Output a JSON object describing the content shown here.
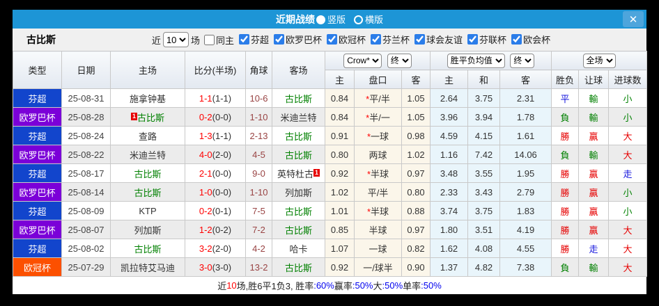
{
  "titlebar": {
    "title": "近期战绩",
    "vertical_label": "竖版",
    "horizontal_label": "横版",
    "close_glyph": "✕"
  },
  "filter": {
    "team": "古比斯",
    "near_label": "近",
    "games_value": "10",
    "games_suffix": "场",
    "same_home": {
      "label": "同主",
      "checked": false
    },
    "leagues": [
      {
        "label": "芬超",
        "checked": true
      },
      {
        "label": "欧罗巴杯",
        "checked": true
      },
      {
        "label": "欧冠杯",
        "checked": true
      },
      {
        "label": "芬兰杯",
        "checked": true
      },
      {
        "label": "球会友谊",
        "checked": true
      },
      {
        "label": "芬联杯",
        "checked": true
      },
      {
        "label": "欧会杯",
        "checked": true
      }
    ]
  },
  "colors": {
    "titlebar": "#1d95d6",
    "win_red": "#e60000",
    "lose_green": "#008000",
    "draw_blue": "#1414dd",
    "focus_team_green": "#008000",
    "score_red": "#ff0000",
    "corner_maroon": "#994444",
    "card_red": "#e60000",
    "percent_blue": "#0000ee"
  },
  "league_colors": {
    "芬超": "#1245cc",
    "欧罗巴杯": "#7b00d8",
    "欧冠杯": "#fc5000"
  },
  "table": {
    "columns_left": [
      "类型",
      "日期",
      "主场",
      "比分(半场)",
      "角球",
      "客场"
    ],
    "sub_columns": [
      "主",
      "盘口",
      "客",
      "主",
      "和",
      "客",
      "胜负",
      "让球",
      "进球数"
    ],
    "group1": {
      "select1": "Crow*",
      "select2": "终"
    },
    "group2": {
      "select1": "胜平负均值",
      "select2": "终"
    },
    "group3": {
      "select1": "全场"
    },
    "focus_team": "古比斯",
    "rows": [
      {
        "league": "芬超",
        "date": "25-08-31",
        "home": "施拿钟基",
        "away": "古比斯",
        "ft": "1-1",
        "ht": "(1-1)",
        "corners": "10-6",
        "crow": [
          "0.84",
          "*平/半",
          "1.05"
        ],
        "avg": [
          "2.64",
          "3.75",
          "2.31"
        ],
        "outcome": "平",
        "handicap": "輸",
        "goals": "小"
      },
      {
        "league": "欧罗巴杯",
        "date": "25-08-28",
        "home": "古比斯",
        "home_card": "1",
        "away": "米迪兰特",
        "ft": "0-2",
        "ht": "(0-0)",
        "corners": "1-10",
        "crow": [
          "0.84",
          "*半/一",
          "1.05"
        ],
        "avg": [
          "3.96",
          "3.94",
          "1.78"
        ],
        "outcome": "負",
        "handicap": "輸",
        "goals": "小"
      },
      {
        "league": "芬超",
        "date": "25-08-24",
        "home": "查路",
        "away": "古比斯",
        "ft": "1-3",
        "ht": "(1-1)",
        "corners": "2-13",
        "crow": [
          "0.91",
          "*一球",
          "0.98"
        ],
        "avg": [
          "4.59",
          "4.15",
          "1.61"
        ],
        "outcome": "勝",
        "handicap": "贏",
        "goals": "大"
      },
      {
        "league": "欧罗巴杯",
        "date": "25-08-22",
        "home": "米迪兰特",
        "away": "古比斯",
        "ft": "4-0",
        "ht": "(2-0)",
        "corners": "4-5",
        "crow": [
          "0.80",
          "两球",
          "1.02"
        ],
        "avg": [
          "1.16",
          "7.42",
          "14.06"
        ],
        "outcome": "負",
        "handicap": "輸",
        "goals": "大"
      },
      {
        "league": "芬超",
        "date": "25-08-17",
        "home": "古比斯",
        "away": "英特杜古",
        "away_card": "1",
        "ft": "2-1",
        "ht": "(0-0)",
        "corners": "9-0",
        "crow": [
          "0.92",
          "*半球",
          "0.97"
        ],
        "avg": [
          "3.48",
          "3.55",
          "1.95"
        ],
        "outcome": "勝",
        "handicap": "贏",
        "goals": "走"
      },
      {
        "league": "欧罗巴杯",
        "date": "25-08-14",
        "home": "古比斯",
        "away": "列加斯",
        "ft": "1-0",
        "ht": "(0-0)",
        "corners": "1-10",
        "crow": [
          "1.02",
          "平/半",
          "0.80"
        ],
        "avg": [
          "2.33",
          "3.43",
          "2.79"
        ],
        "outcome": "勝",
        "handicap": "贏",
        "goals": "小"
      },
      {
        "league": "芬超",
        "date": "25-08-09",
        "home": "KTP",
        "away": "古比斯",
        "ft": "0-2",
        "ht": "(0-1)",
        "corners": "7-5",
        "crow": [
          "1.01",
          "*半球",
          "0.88"
        ],
        "avg": [
          "3.74",
          "3.75",
          "1.83"
        ],
        "outcome": "勝",
        "handicap": "贏",
        "goals": "小"
      },
      {
        "league": "欧罗巴杯",
        "date": "25-08-07",
        "home": "列加斯",
        "away": "古比斯",
        "ft": "1-2",
        "ht": "(0-2)",
        "corners": "7-2",
        "crow": [
          "0.85",
          "半球",
          "0.97"
        ],
        "avg": [
          "1.80",
          "3.51",
          "4.19"
        ],
        "outcome": "勝",
        "handicap": "贏",
        "goals": "大"
      },
      {
        "league": "芬超",
        "date": "25-08-02",
        "home": "古比斯",
        "away": "哈卡",
        "ft": "3-2",
        "ht": "(2-0)",
        "corners": "4-2",
        "crow": [
          "1.07",
          "一球",
          "0.82"
        ],
        "avg": [
          "1.62",
          "4.08",
          "4.55"
        ],
        "outcome": "勝",
        "handicap": "走",
        "goals": "大"
      },
      {
        "league": "欧冠杯",
        "date": "25-07-29",
        "home": "凯拉特艾马迪",
        "away": "古比斯",
        "ft": "3-0",
        "ht": "(3-0)",
        "corners": "13-2",
        "crow": [
          "0.92",
          "一/球半",
          "0.90"
        ],
        "avg": [
          "1.37",
          "4.82",
          "7.38"
        ],
        "outcome": "負",
        "handicap": "輸",
        "goals": "大"
      }
    ]
  },
  "footer": {
    "segments": [
      [
        "近",
        ""
      ],
      [
        "10",
        "red"
      ],
      [
        "场,胜6平1负3, 胜率",
        ""
      ],
      [
        ":60%",
        "blue"
      ],
      [
        " 赢率",
        ""
      ],
      [
        ":50%",
        "blue"
      ],
      [
        " 大",
        ""
      ],
      [
        ":50%",
        "blue"
      ],
      [
        " 单率",
        ""
      ],
      [
        ":50%",
        "blue"
      ]
    ]
  }
}
